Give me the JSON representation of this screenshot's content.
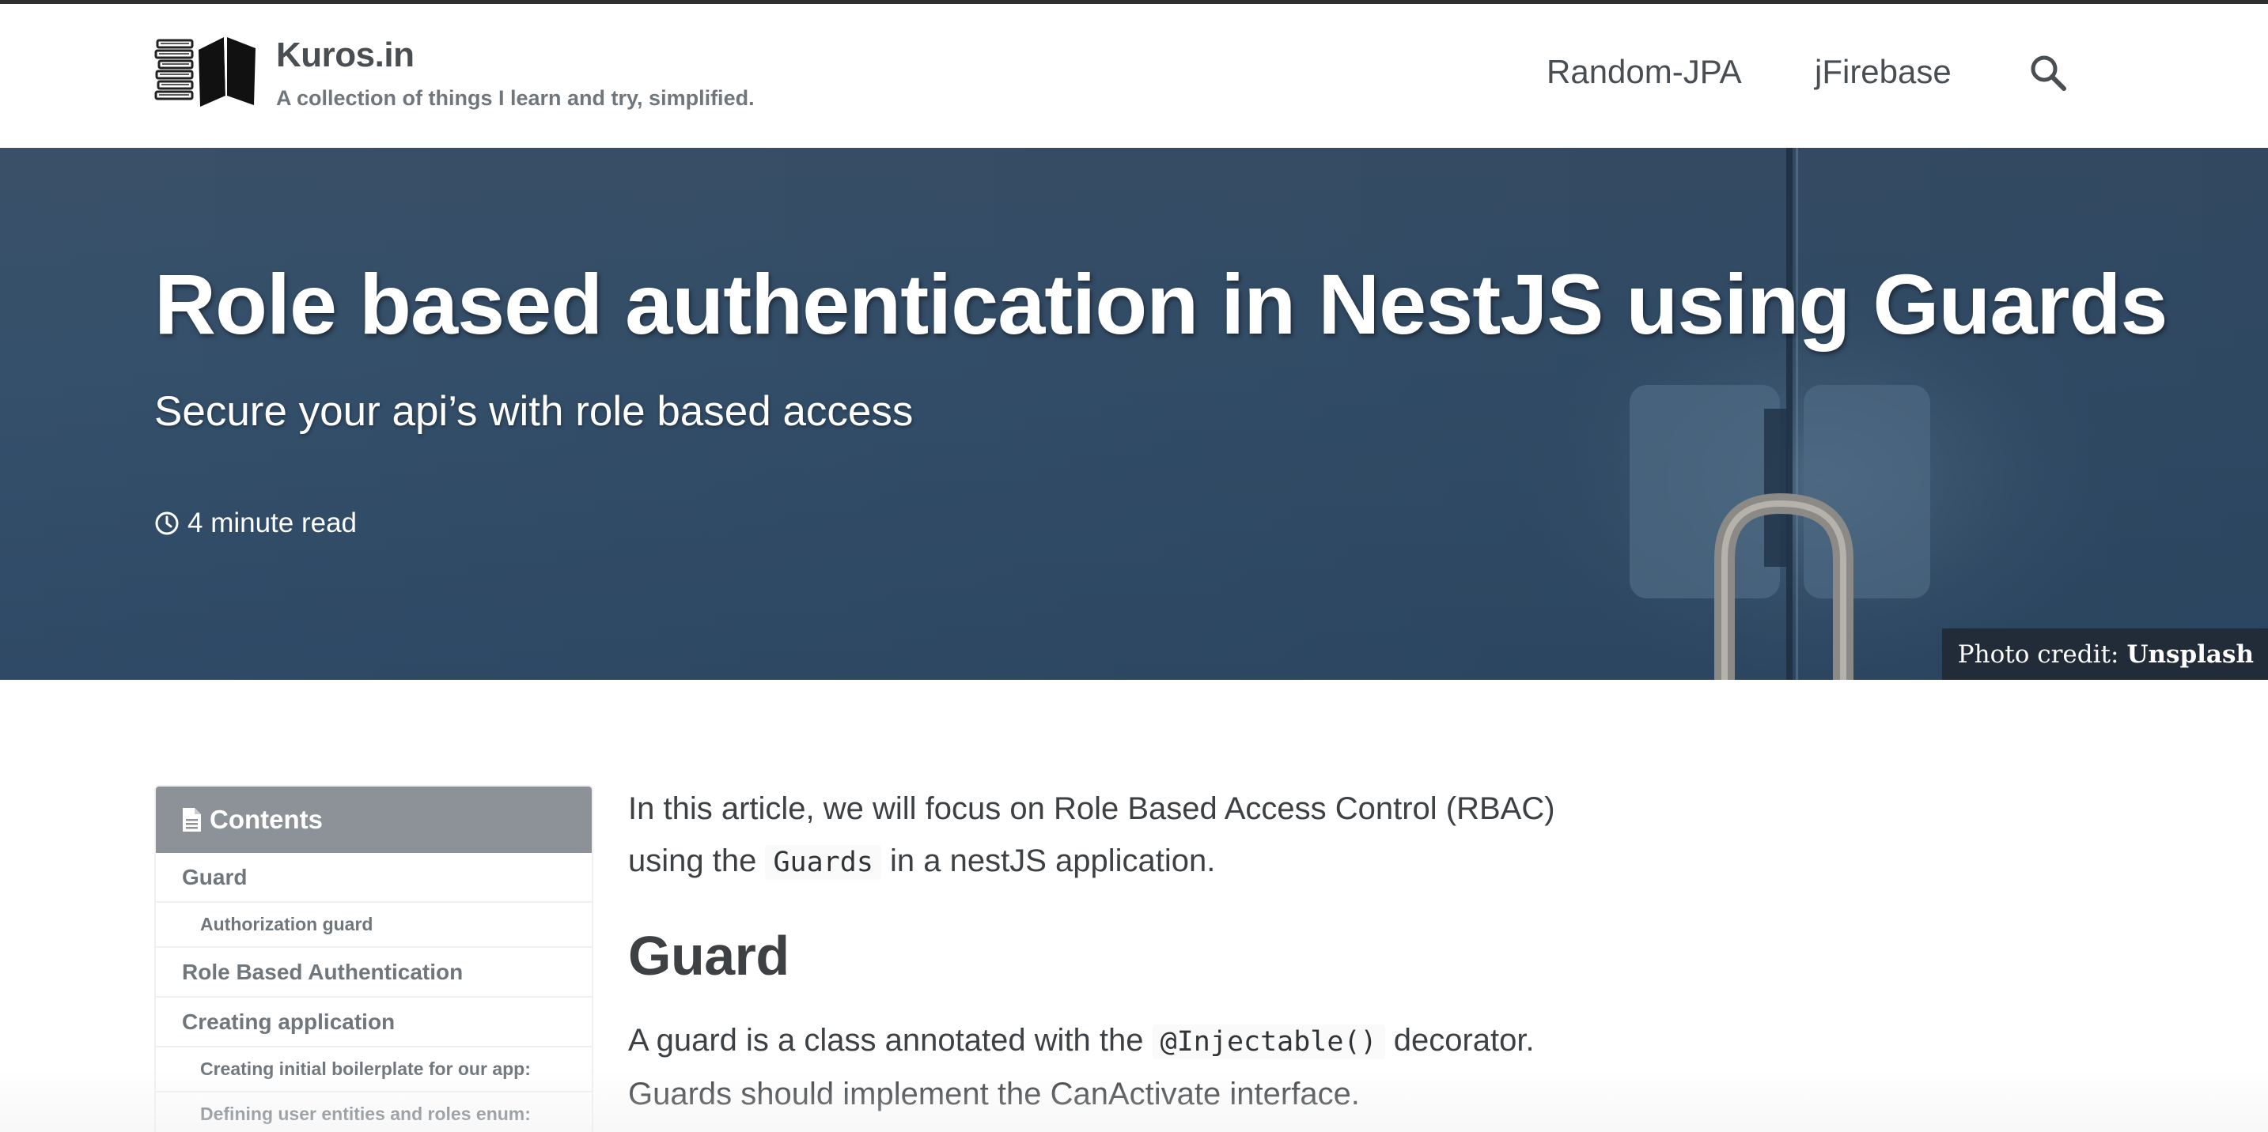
{
  "masthead": {
    "site_title": "Kuros.in",
    "site_subtitle": "A collection of things I learn and try, simplified.",
    "nav": [
      {
        "label": "Random-JPA"
      },
      {
        "label": "jFirebase"
      }
    ],
    "search_icon": "search-icon",
    "logo_icon": "books-logo"
  },
  "hero": {
    "title": "Role based authentication in NestJS using Guards",
    "excerpt": "Secure your api’s with role based access",
    "read_time": "4 minute read",
    "photo_credit_prefix": "Photo credit:",
    "photo_credit_link": "Unsplash"
  },
  "toc": {
    "title": "Contents",
    "items": [
      {
        "label": "Guard",
        "level": 1
      },
      {
        "label": "Authorization guard",
        "level": 2
      },
      {
        "label": "Role Based Authentication",
        "level": 1
      },
      {
        "label": "Creating application",
        "level": 1
      },
      {
        "label": "Creating initial boilerplate for our app:",
        "level": 2
      },
      {
        "label": "Defining user entities and roles enum:",
        "level": 2
      }
    ]
  },
  "article": {
    "intro_part1": "In this article, we will focus on Role Based Access Control (RBAC)",
    "intro_part2": "using the",
    "intro_code": "Guards",
    "intro_part3": "in a nestJS application.",
    "heading_guard": "Guard",
    "guard_part1": "A guard is a class annotated with the",
    "guard_code": "@Injectable()",
    "guard_part2": "decorator.",
    "guard_part3": "Guards should implement the CanActivate interface."
  },
  "colors": {
    "hero_bg": "#35506b",
    "toc_header": "#8c9297",
    "text": "#494e52"
  }
}
